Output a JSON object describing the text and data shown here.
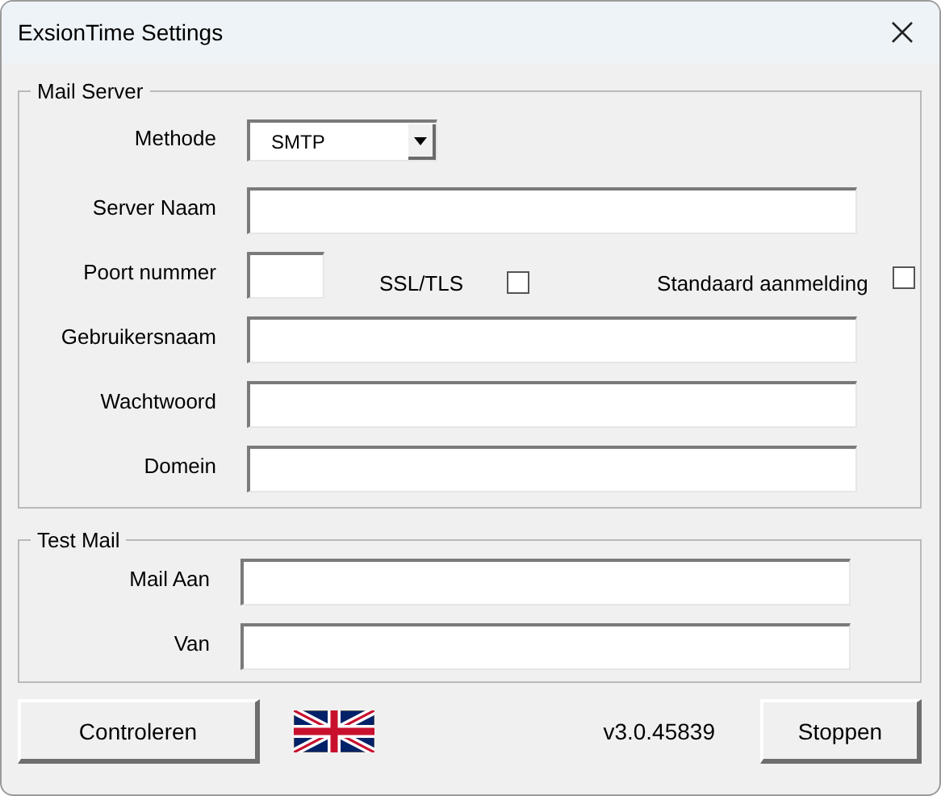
{
  "window": {
    "title": "ExsionTime Settings"
  },
  "mail_server": {
    "legend": "Mail Server",
    "rows": [
      {
        "kind": "select",
        "label": "Methode",
        "value": "SMTP"
      },
      {
        "kind": "text",
        "label": "Server Naam"
      },
      {
        "kind": "port",
        "label": "Poort nummer",
        "checkboxes": [
          {
            "label": "SSL/TLS",
            "checked": false
          },
          {
            "label": "Standaard aanmelding",
            "checked": false
          }
        ]
      },
      {
        "kind": "text",
        "label": "Gebruikersnaam"
      },
      {
        "kind": "text",
        "label": "Wachtwoord"
      },
      {
        "kind": "text",
        "label": "Domein"
      }
    ]
  },
  "test_mail": {
    "legend": "Test Mail",
    "rows": [
      {
        "kind": "text",
        "label": "Mail Aan"
      },
      {
        "kind": "text",
        "label": "Van"
      }
    ]
  },
  "footer": {
    "check_button": "Controleren",
    "version": "v3.0.45839",
    "stop_button": "Stoppen"
  }
}
